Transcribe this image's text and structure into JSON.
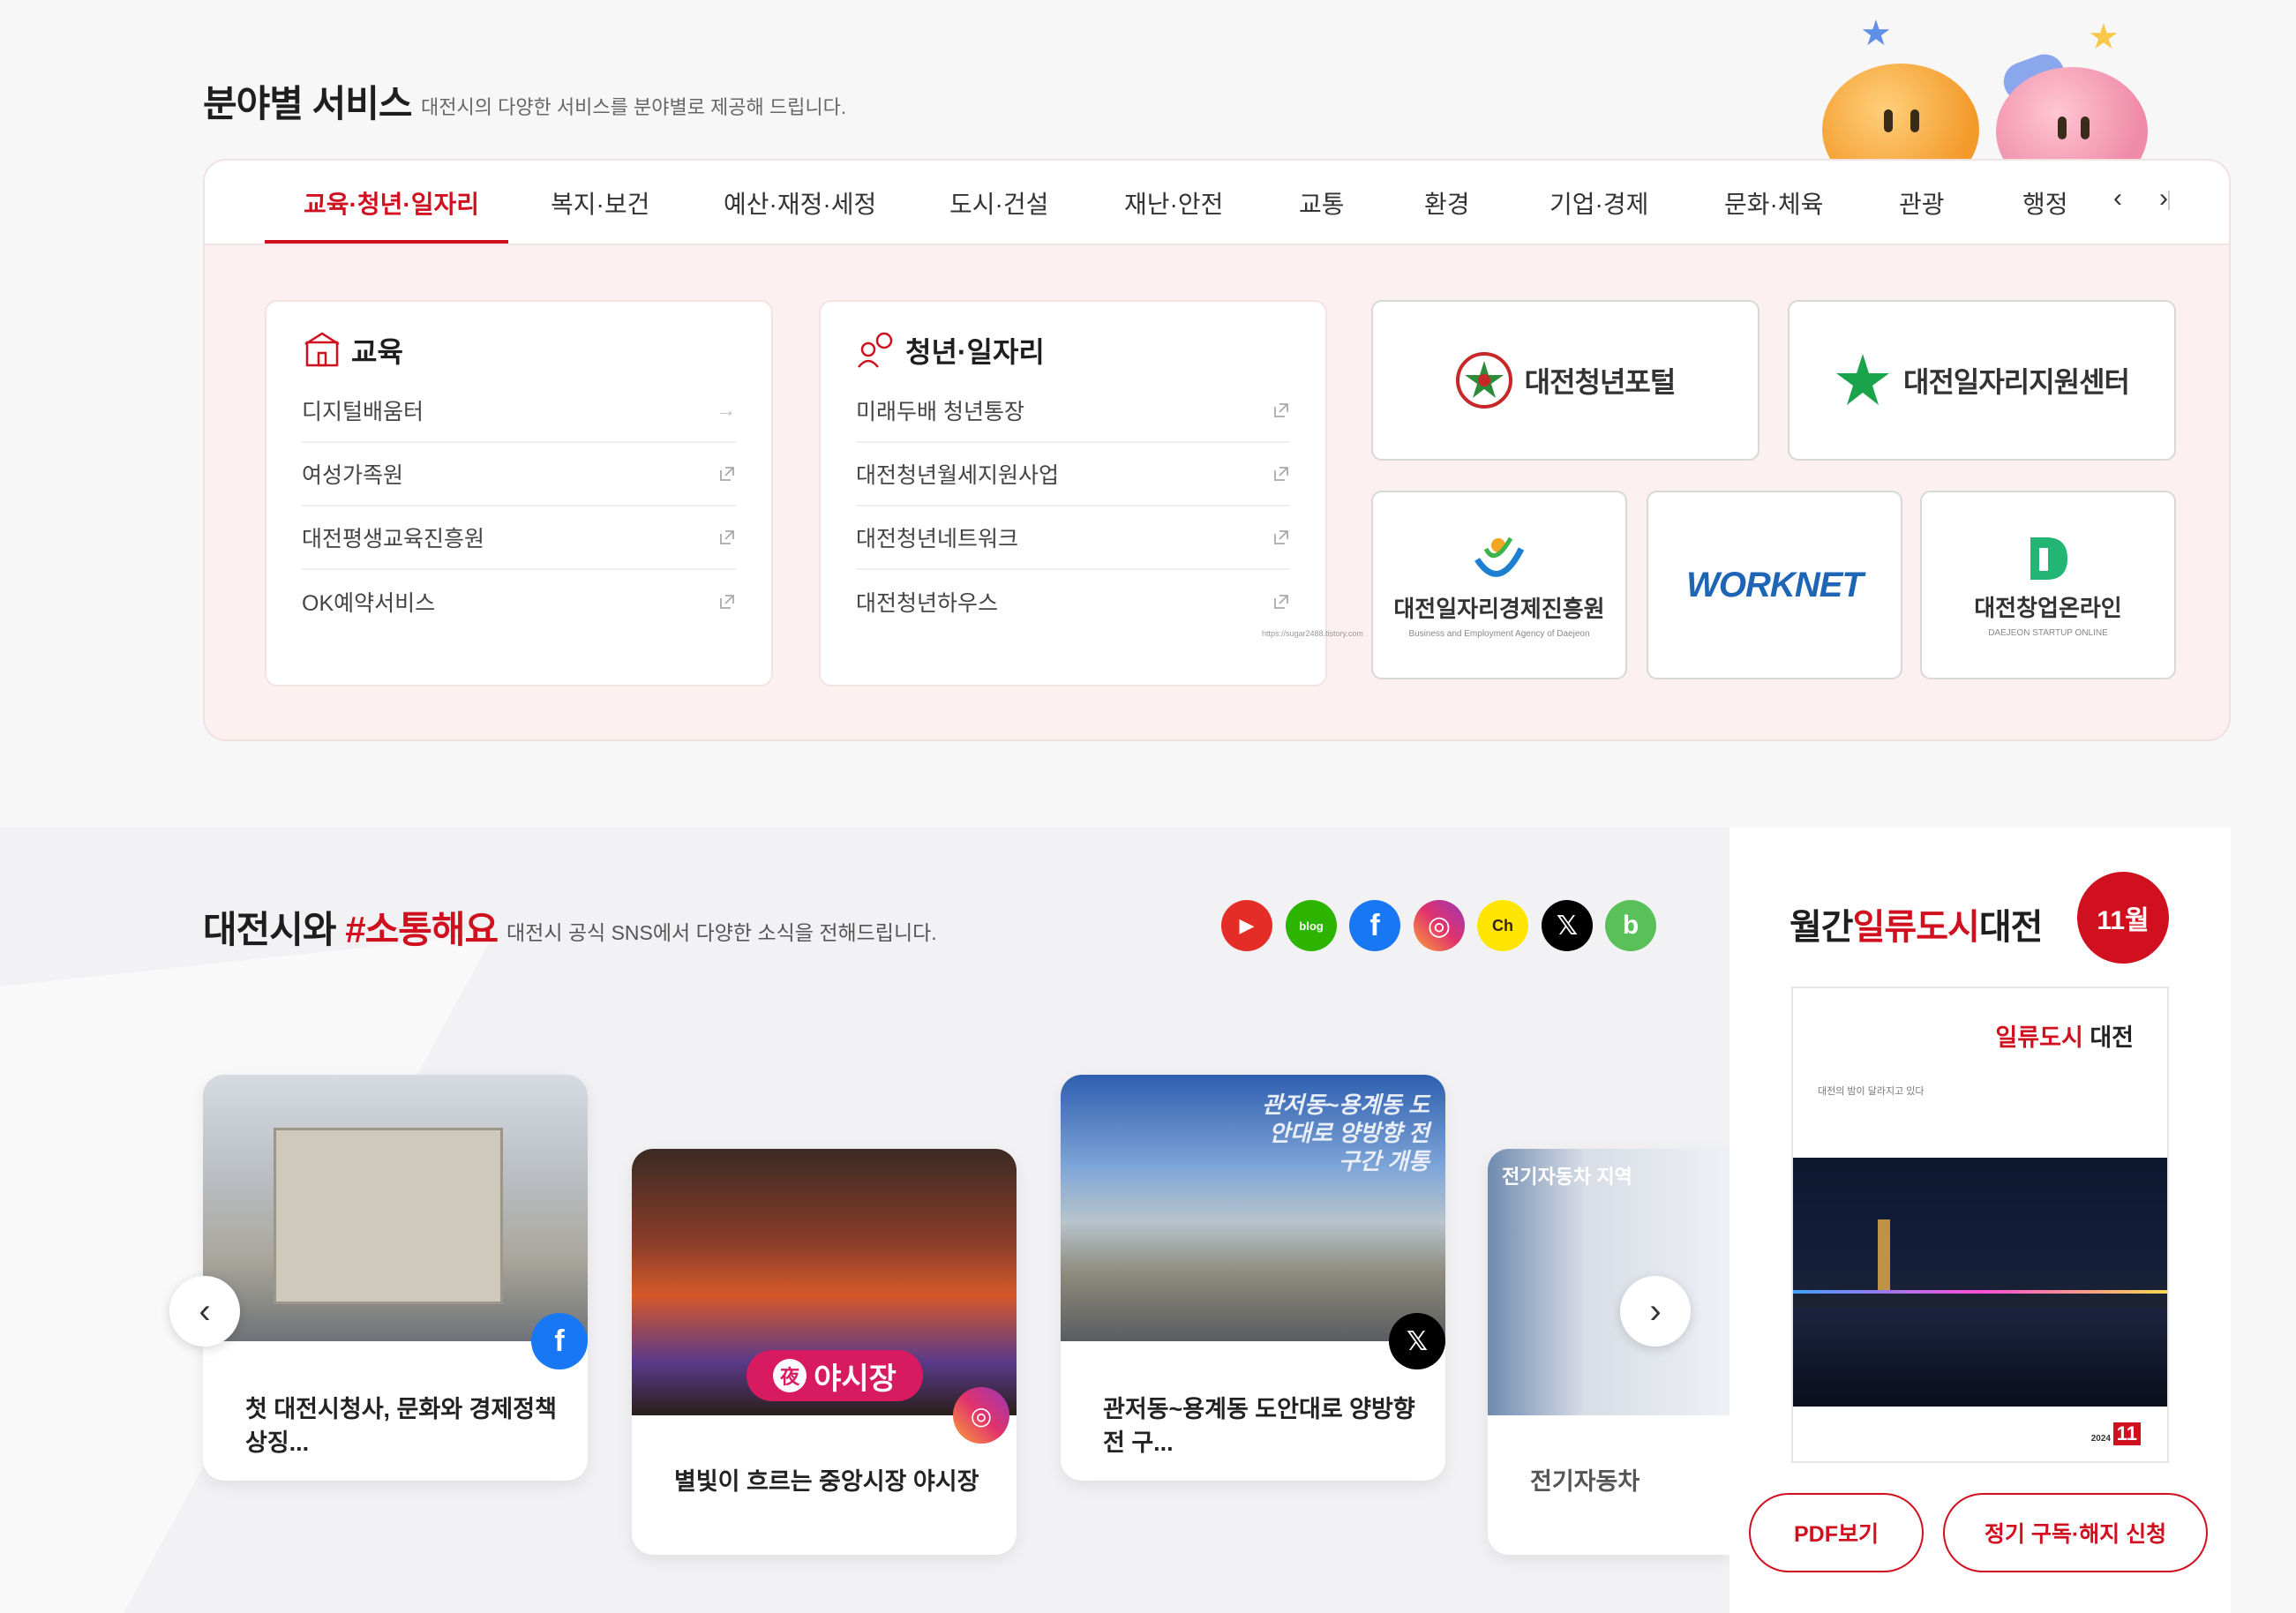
{
  "services": {
    "title": "분야별 서비스",
    "subtitle": "대전시의 다양한 서비스를 분야별로 제공해 드립니다.",
    "tabs": [
      "교육·청년·일자리",
      "복지·보건",
      "예산·재정·세정",
      "도시·건설",
      "재난·안전",
      "교통",
      "환경",
      "기업·경제",
      "문화·체육",
      "관광",
      "행정"
    ],
    "education": {
      "title": "교육",
      "links": [
        "디지털배움터",
        "여성가족원",
        "대전평생교육진흥원",
        "OK예약서비스"
      ]
    },
    "youth": {
      "title": "청년·일자리",
      "links": [
        "미래두배 청년통장",
        "대전청년월세지원사업",
        "대전청년네트워크",
        "대전청년하우스"
      ]
    },
    "banners": {
      "youth_portal": "대전청년포털",
      "job_center": "대전일자리지원센터",
      "agency_name": "대전일자리경제진흥원",
      "agency_en": "Business and Employment Agency of Daejeon",
      "worknet": "WORKNET",
      "startup": "대전창업온라인",
      "startup_en": "DAEJEON STARTUP ONLINE"
    },
    "tiny_url": "https://sugar2488.tistory.com"
  },
  "sns": {
    "title_prefix": "대전시와 ",
    "title_highlight": "#소통해요",
    "subtitle": "대전시 공식 SNS에서 다양한 소식을 전해드립니다.",
    "icons": [
      {
        "name": "youtube-icon",
        "color": "#e52d27",
        "glyph": "▶"
      },
      {
        "name": "blog-icon",
        "color": "#2db400",
        "glyph": "blog"
      },
      {
        "name": "facebook-icon",
        "color": "#1877f2",
        "glyph": "f"
      },
      {
        "name": "instagram-icon",
        "color": "#d6249f",
        "glyph": "◎"
      },
      {
        "name": "kakao-channel-icon",
        "color": "#fee500",
        "glyph": "Ch"
      },
      {
        "name": "x-icon",
        "color": "#000000",
        "glyph": "𝕏"
      },
      {
        "name": "band-icon",
        "color": "#5ac15a",
        "glyph": "b"
      }
    ],
    "posts": [
      {
        "text": "첫 대전시청사, 문화와 경제정책 상징...",
        "platform": "facebook"
      },
      {
        "text": "별빛이 흐르는 중앙시장 야시장",
        "platform": "instagram",
        "img_caption": "야시장",
        "img_sign": "夜"
      },
      {
        "text": "관저동~용계동 도안대로 양방향 전 구...",
        "platform": "x",
        "img_caption": "관저동~용계동 도안대로 양방향 전 구간 개통"
      },
      {
        "text": "전기자동차",
        "img_caption": "전기자동차 지역"
      }
    ]
  },
  "magazine": {
    "title_prefix": "월간",
    "title_highlight": "일류도시",
    "title_suffix": "대전",
    "month": "11월",
    "cover_brand": "일류도시",
    "cover_brand_suffix": "대전",
    "cover_headline": "대전의 밤이 달라지고 있다",
    "cover_year": "2024",
    "cover_issue": "11",
    "pdf_button": "PDF보기",
    "subscribe_button": "정기 구독·해지 신청"
  },
  "colors": {
    "accent": "#d1101f"
  }
}
